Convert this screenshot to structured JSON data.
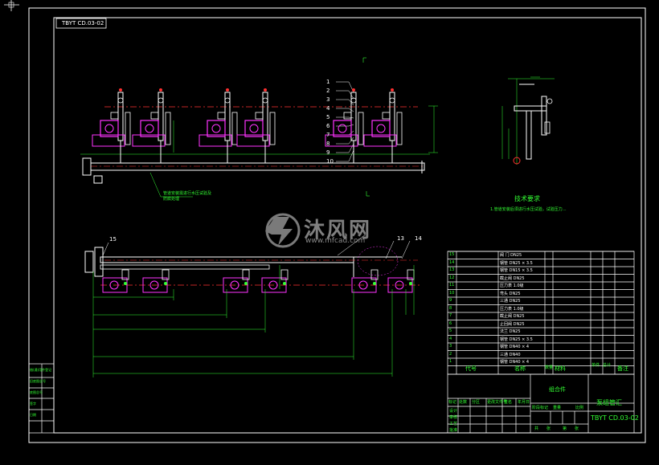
{
  "drawing": {
    "drawing_no": "TBYT CD.03-02",
    "drawing_no_top": "TBYT CD.03-02",
    "tech_title": "技术要求",
    "tech_note": "1.管道安装后须进行水压试验，试验压力...",
    "leader_note": "管道安装需进行水压试验及防腐处理",
    "balloons": [
      "1",
      "2",
      "3",
      "4",
      "5",
      "6",
      "7",
      "8",
      "9",
      "10",
      "13",
      "14",
      "15"
    ],
    "colors": {
      "frame": "#ffffff",
      "pipe": "#ffffff",
      "centerline": "#ff3030",
      "pump": "#ff33ff",
      "dim": "#33ff33",
      "text": "#33ff33"
    }
  },
  "bom": {
    "rows": [
      {
        "no": "15",
        "name": "阀 门 DN25"
      },
      {
        "no": "14",
        "name": "钢管 DN25 × 3.5"
      },
      {
        "no": "13",
        "name": "钢管 DN15 × 3.5"
      },
      {
        "no": "12",
        "name": "截止阀 DN25"
      },
      {
        "no": "11",
        "name": "压力表 1.0级"
      },
      {
        "no": "10",
        "name": "弯头 DN25"
      },
      {
        "no": "9",
        "name": "三通 DN25"
      },
      {
        "no": "8",
        "name": "压力表 1.0级"
      },
      {
        "no": "7",
        "name": "截止阀 DN25"
      },
      {
        "no": "6",
        "name": "止回阀 DN25"
      },
      {
        "no": "5",
        "name": "法兰 DN25"
      },
      {
        "no": "4",
        "name": "钢管 DN25 × 3.5"
      },
      {
        "no": "3",
        "name": "钢管 DN40 × 4"
      },
      {
        "no": "2",
        "name": "三通 DN40"
      },
      {
        "no": "1",
        "name": "钢管 DN40 × 4"
      }
    ],
    "header": {
      "no": "代号",
      "name": "名称",
      "qty": "数量",
      "material": "材料",
      "weight_single": "单件",
      "weight_total": "总计",
      "remark": "备注"
    }
  },
  "title_block": {
    "title": "泵组管汇",
    "drawing_no": "TBYT CD.03-02",
    "assembly": "组合件",
    "labels": [
      "标记",
      "处数",
      "分区",
      "更改文件号",
      "签名",
      "年月日"
    ],
    "approve_labels": [
      "设计",
      "审核",
      "工艺",
      "批准"
    ],
    "scale_labels": [
      "阶段标记",
      "重量",
      "比例"
    ],
    "sheet_labels": [
      "共",
      "张",
      "第",
      "张"
    ]
  },
  "left_stamp": {
    "items": [
      "借(通)用件登记",
      "旧底图总号",
      "底图总号",
      "签字",
      "日期"
    ]
  },
  "watermark": {
    "brand": "沐风网",
    "url": "www.mfcad.com"
  }
}
